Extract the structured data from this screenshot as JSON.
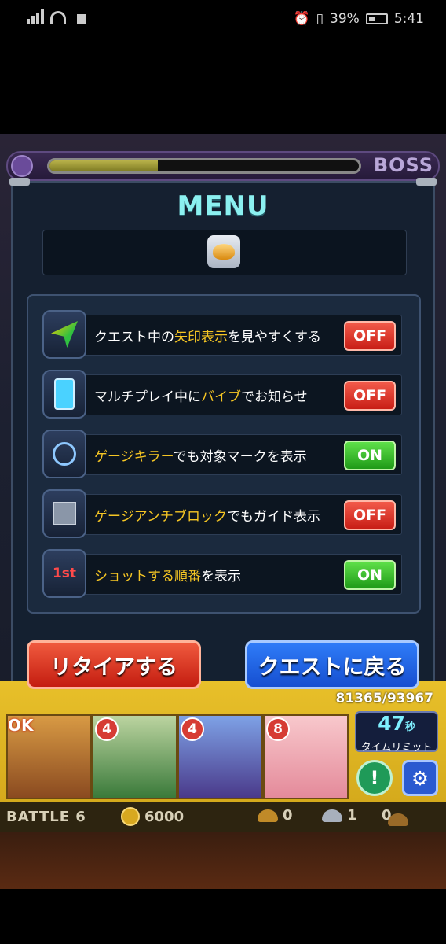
{
  "status_bar": {
    "battery": "39%",
    "time": "5:41"
  },
  "top_bar": {
    "boss_label": "BOSS",
    "boss_hp_fraction": 0.35
  },
  "menu": {
    "title": "MENU",
    "items": [
      {
        "pre": "クエスト中の",
        "hl": "矢印表示",
        "post": "を見やすくする",
        "toggle": "OFF",
        "icon": "arrow-icon"
      },
      {
        "pre": "マルチプレイ中に",
        "hl": "バイブ",
        "post": "でお知らせ",
        "toggle": "OFF",
        "icon": "vibrate-phone-icon"
      },
      {
        "pre": "",
        "hl": "ゲージキラー",
        "post": "でも対象マークを表示",
        "toggle": "ON",
        "icon": "target-icon"
      },
      {
        "pre": "",
        "hl": "ゲージアンチブロック",
        "post": "でもガイド表示",
        "toggle": "OFF",
        "icon": "block-icon"
      },
      {
        "pre": "",
        "hl": "ショットする順番",
        "post": "を表示",
        "toggle": "ON",
        "icon": "first-order-icon",
        "icon_text": "1st"
      }
    ],
    "retire_button": "リタイアする",
    "back_button": "クエストに戻る"
  },
  "party": {
    "total": "81365/93967",
    "monsters": [
      {
        "badge": "OK"
      },
      {
        "badge": "4"
      },
      {
        "badge": "4"
      },
      {
        "badge": "8"
      }
    ],
    "timer_value": "47",
    "timer_unit": "秒",
    "timer_label": "タイムリミット"
  },
  "battle": {
    "label": "BATTLE",
    "number": "6",
    "gold": "6000",
    "gold_eggs": "0",
    "silver_eggs": "1",
    "bronze_eggs": "0"
  },
  "colors": {
    "highlight": "#f6c624",
    "off": "#d8281e",
    "on": "#2ea824",
    "title": "#8bf0f0"
  }
}
